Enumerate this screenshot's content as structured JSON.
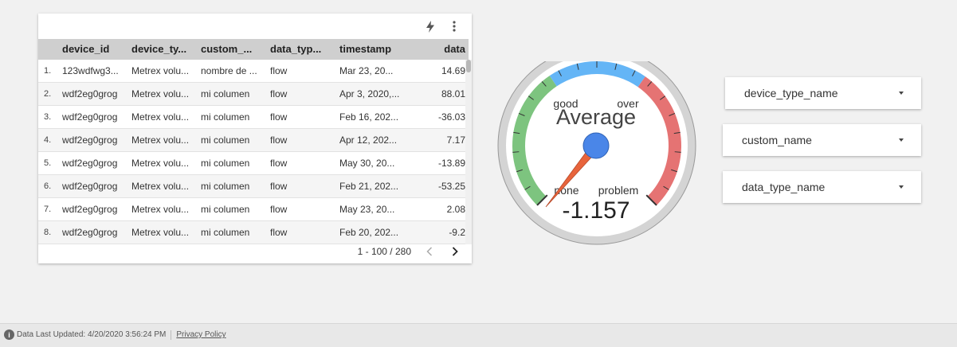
{
  "table": {
    "columns": [
      "device_id",
      "device_ty...",
      "custom_...",
      "data_typ...",
      "timestamp",
      "data"
    ],
    "rows": [
      {
        "n": "1.",
        "device_id": "123wdfwg3...",
        "device_type": "Metrex volu...",
        "custom": "nombre de ...",
        "data_type": "flow",
        "timestamp": "Mar 23, 20...",
        "data": "14.69"
      },
      {
        "n": "2.",
        "device_id": "wdf2eg0grog",
        "device_type": "Metrex volu...",
        "custom": "mi columen",
        "data_type": "flow",
        "timestamp": "Apr 3, 2020,...",
        "data": "88.01"
      },
      {
        "n": "3.",
        "device_id": "wdf2eg0grog",
        "device_type": "Metrex volu...",
        "custom": "mi columen",
        "data_type": "flow",
        "timestamp": "Feb 16, 202...",
        "data": "-36.03"
      },
      {
        "n": "4.",
        "device_id": "wdf2eg0grog",
        "device_type": "Metrex volu...",
        "custom": "mi columen",
        "data_type": "flow",
        "timestamp": "Apr 12, 202...",
        "data": "7.17"
      },
      {
        "n": "5.",
        "device_id": "wdf2eg0grog",
        "device_type": "Metrex volu...",
        "custom": "mi columen",
        "data_type": "flow",
        "timestamp": "May 30, 20...",
        "data": "-13.89"
      },
      {
        "n": "6.",
        "device_id": "wdf2eg0grog",
        "device_type": "Metrex volu...",
        "custom": "mi columen",
        "data_type": "flow",
        "timestamp": "Feb 21, 202...",
        "data": "-53.25"
      },
      {
        "n": "7.",
        "device_id": "wdf2eg0grog",
        "device_type": "Metrex volu...",
        "custom": "mi columen",
        "data_type": "flow",
        "timestamp": "May 23, 20...",
        "data": "2.08"
      },
      {
        "n": "8.",
        "device_id": "wdf2eg0grog",
        "device_type": "Metrex volu...",
        "custom": "mi columen",
        "data_type": "flow",
        "timestamp": "Feb 20, 202...",
        "data": "-9.2"
      }
    ],
    "pagination": "1 - 100 / 280",
    "tools": {
      "quick_action_icon": "lightning-bolt-icon",
      "more_icon": "more-vertical-icon"
    }
  },
  "gauge": {
    "title": "Average",
    "value": "-1.157",
    "labels": {
      "none": "none",
      "good": "good",
      "over": "over",
      "problem": "problem"
    },
    "colors": {
      "green": "#7dc47f",
      "blue": "#64b5f6",
      "red": "#e57373",
      "needle": "#e8643c",
      "hub": "#4a86e8"
    }
  },
  "filters": [
    {
      "label": "device_type_name"
    },
    {
      "label": "custom_name"
    },
    {
      "label": "data_type_name"
    }
  ],
  "footer": {
    "updated": "Data Last Updated: 4/20/2020 3:56:24 PM",
    "privacy": "Privacy Policy"
  }
}
